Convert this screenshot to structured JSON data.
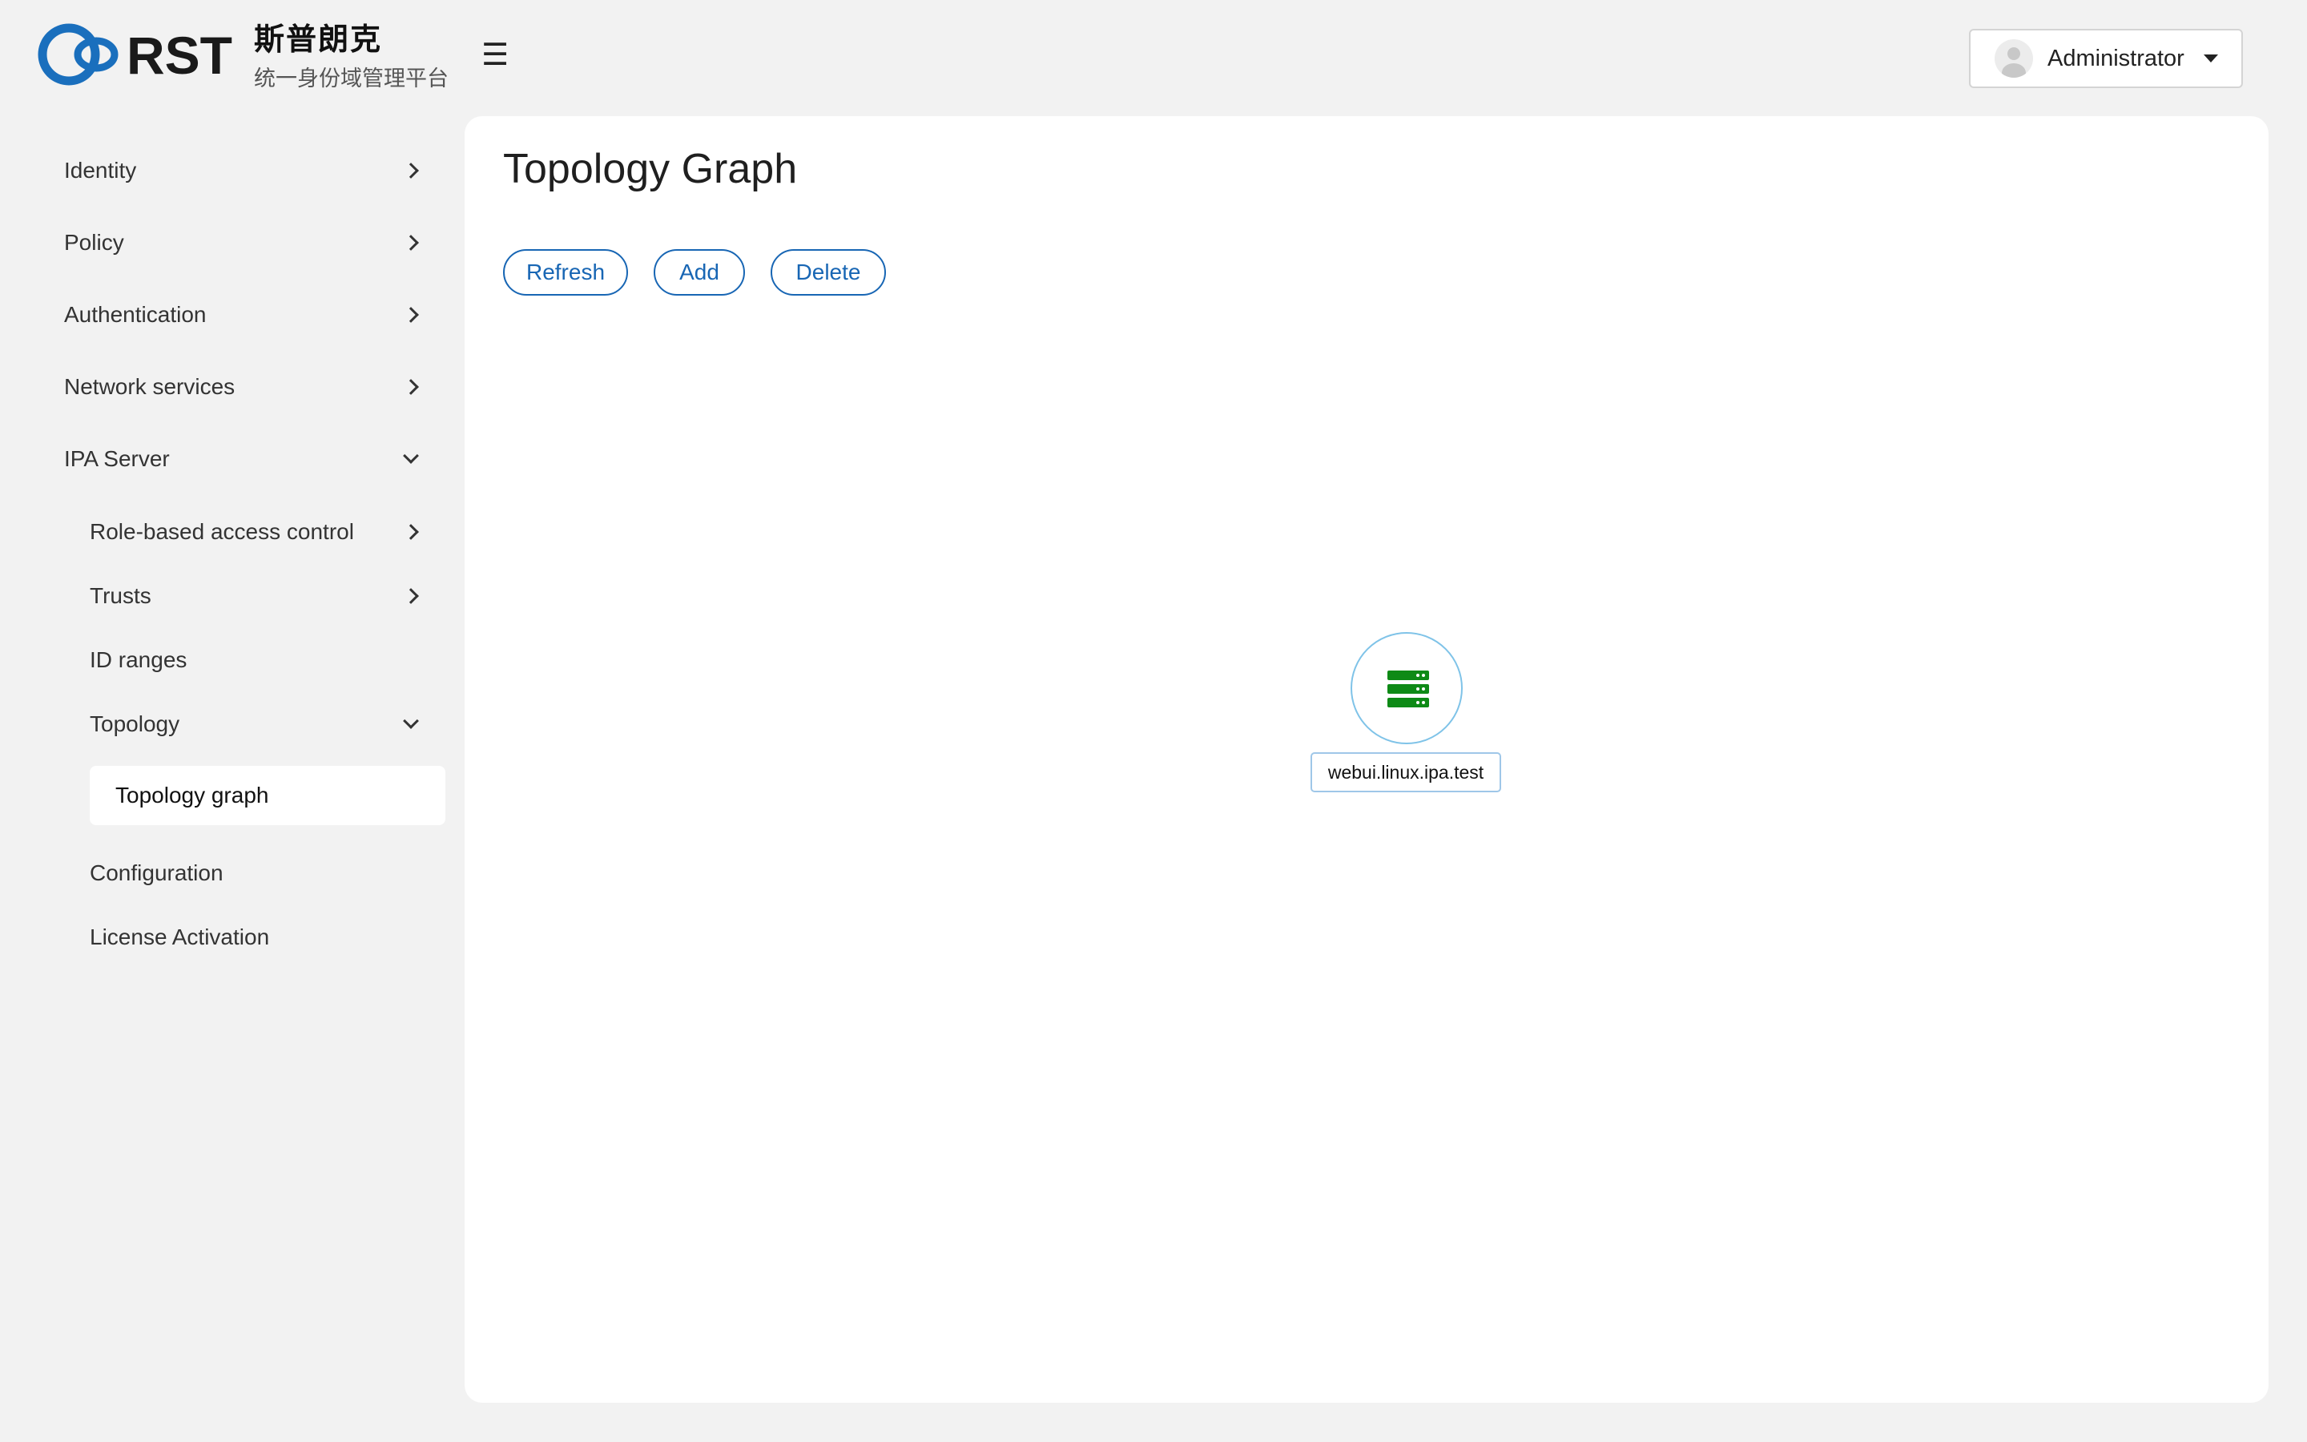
{
  "header": {
    "brand_title": "斯普朗克",
    "brand_subtitle": "统一身份域管理平台",
    "logo_text": "RST",
    "menu_toggle": "☰",
    "user_name": "Administrator"
  },
  "sidebar": {
    "items": [
      {
        "label": "Identity",
        "chevron": "right"
      },
      {
        "label": "Policy",
        "chevron": "right"
      },
      {
        "label": "Authentication",
        "chevron": "right"
      },
      {
        "label": "Network services",
        "chevron": "right"
      },
      {
        "label": "IPA Server",
        "chevron": "down"
      }
    ],
    "ipa_server": {
      "items": [
        {
          "label": "Role-based access control",
          "chevron": "right"
        },
        {
          "label": "Trusts",
          "chevron": "right"
        },
        {
          "label": "ID ranges"
        },
        {
          "label": "Topology",
          "chevron": "down"
        },
        {
          "label": "Topology graph",
          "active": true
        },
        {
          "label": "Configuration"
        },
        {
          "label": "License Activation"
        }
      ]
    }
  },
  "main": {
    "title": "Topology Graph",
    "buttons": {
      "refresh": "Refresh",
      "add": "Add",
      "delete": "Delete"
    },
    "graph": {
      "nodes": [
        {
          "label": "webui.linux.ipa.test",
          "icon": "server-icon",
          "status_color": "#0e8a16"
        }
      ]
    }
  },
  "colors": {
    "accent": "#1866b4",
    "brand_blue": "#1a6fbd",
    "server_green": "#0e8a16",
    "node_border": "#7fc3e8"
  }
}
